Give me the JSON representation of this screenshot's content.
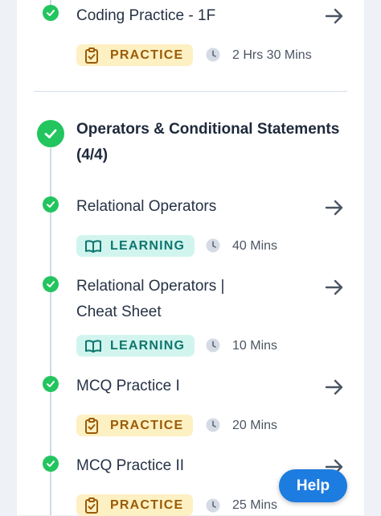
{
  "items_top": [
    {
      "title": "Coding Practice - 1F",
      "badge": "PRACTICE",
      "duration": "2 Hrs 30 Mins"
    }
  ],
  "section": {
    "title": "Operators & Conditional Statements (4/4)"
  },
  "items": [
    {
      "title": "Relational Operators",
      "badge": "LEARNING",
      "duration": "40 Mins"
    },
    {
      "title_line1": "Relational Operators |",
      "title_line2": "Cheat Sheet",
      "badge": "LEARNING",
      "duration": "10 Mins"
    },
    {
      "title": "MCQ Practice I",
      "badge": "PRACTICE",
      "duration": "20 Mins"
    },
    {
      "title": "MCQ Practice II",
      "badge": "PRACTICE",
      "duration": "25 Mins"
    }
  ],
  "help": {
    "label": "Help"
  },
  "colors": {
    "success": "#22c55e",
    "practice_bg": "#fdf0c2",
    "learning_bg": "#d1f5ee",
    "help_bg": "#1d7ce0"
  },
  "icons": {
    "check": "check-icon",
    "arrow": "arrow-right-icon",
    "clock": "clock-icon",
    "clipboard": "clipboard-icon",
    "book": "book-open-icon"
  }
}
